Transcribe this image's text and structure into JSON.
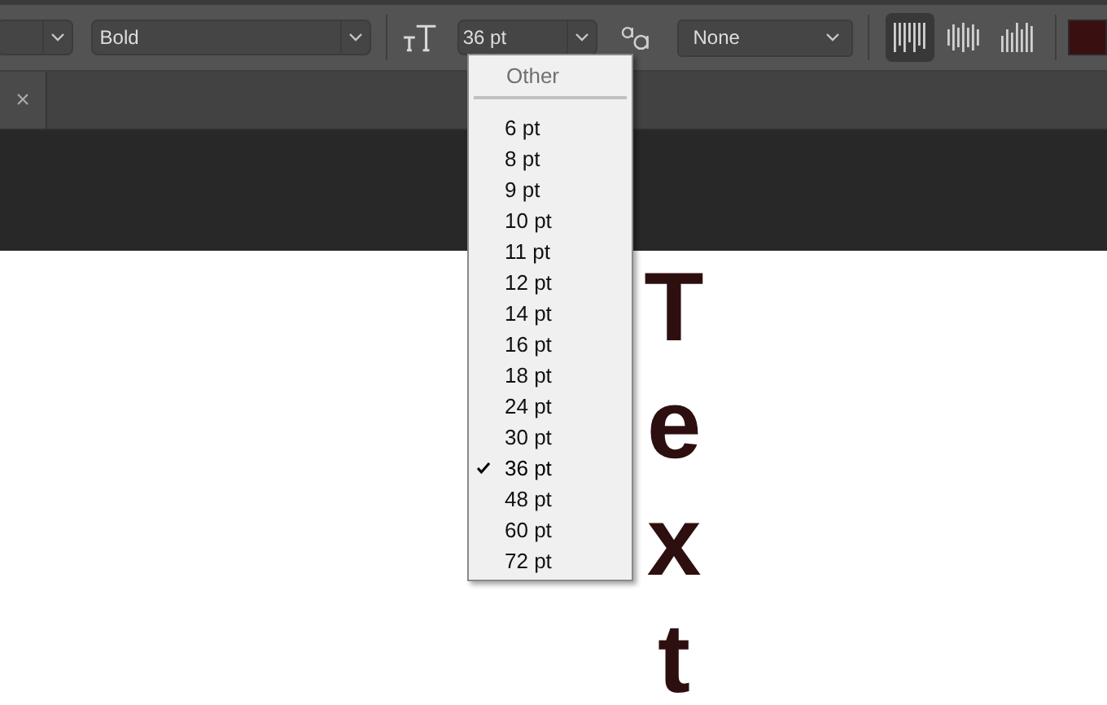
{
  "toolbar": {
    "font_style": {
      "value": "Bold"
    },
    "font_size": {
      "value": "36 pt"
    },
    "anti_aliasing": {
      "value": "None"
    },
    "alignment": [
      {
        "kind": "left",
        "selected": true
      },
      {
        "kind": "center",
        "selected": false
      },
      {
        "kind": "right",
        "selected": false
      }
    ],
    "text_color": {
      "color": "#3a0f10"
    }
  },
  "tabs": [
    {
      "close": "×"
    }
  ],
  "size_menu": {
    "header": "Other",
    "items": [
      {
        "label": "6 pt",
        "selected": false
      },
      {
        "label": "8 pt",
        "selected": false
      },
      {
        "label": "9 pt",
        "selected": false
      },
      {
        "label": "10 pt",
        "selected": false
      },
      {
        "label": "11 pt",
        "selected": false
      },
      {
        "label": "12 pt",
        "selected": false
      },
      {
        "label": "14 pt",
        "selected": false
      },
      {
        "label": "16 pt",
        "selected": false
      },
      {
        "label": "18 pt",
        "selected": false
      },
      {
        "label": "24 pt",
        "selected": false
      },
      {
        "label": "30 pt",
        "selected": false
      },
      {
        "label": "36 pt",
        "selected": true
      },
      {
        "label": "48 pt",
        "selected": false
      },
      {
        "label": "60 pt",
        "selected": false
      },
      {
        "label": "72 pt",
        "selected": false
      }
    ]
  },
  "canvas": {
    "letters": [
      "T",
      "e",
      "x",
      "t"
    ]
  }
}
